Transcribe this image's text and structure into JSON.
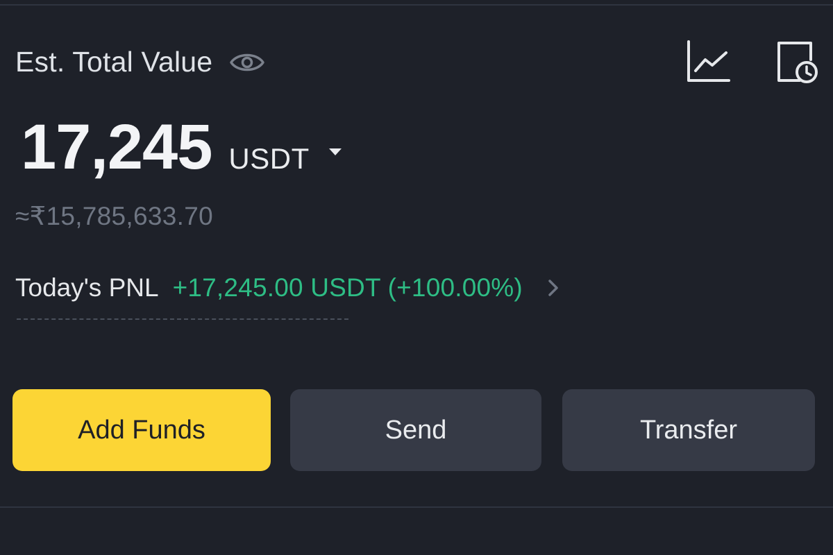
{
  "header": {
    "title": "Est. Total Value",
    "icons": [
      "eye-icon",
      "line-chart-icon",
      "history-icon"
    ]
  },
  "balance": {
    "amount": "17,245",
    "currency": "USDT",
    "fiat_value": "≈₹15,785,633.70"
  },
  "pnl": {
    "label": "Today's PNL",
    "value": "+17,245.00 USDT (+100.00%)"
  },
  "actions": {
    "add_funds": "Add Funds",
    "send": "Send",
    "transfer": "Transfer"
  },
  "colors": {
    "background": "#1e2129",
    "accent_yellow": "#fcd535",
    "positive_green": "#2ebd85",
    "secondary_button": "#363a46",
    "muted_text": "#6f7683"
  }
}
